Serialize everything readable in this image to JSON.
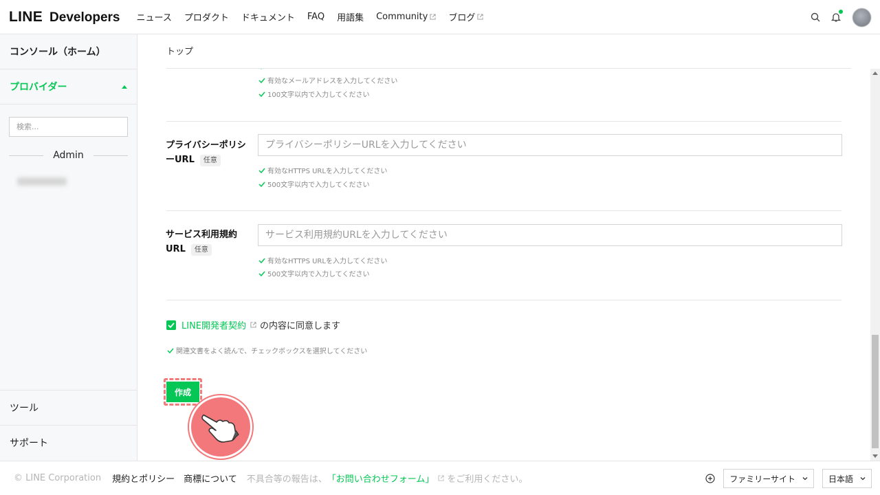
{
  "header": {
    "logo_line": "LINE",
    "logo_dev": "Developers",
    "nav": [
      {
        "label": "ニュース",
        "external": false
      },
      {
        "label": "プロダクト",
        "external": false
      },
      {
        "label": "ドキュメント",
        "external": false
      },
      {
        "label": "FAQ",
        "external": false
      },
      {
        "label": "用語集",
        "external": false
      },
      {
        "label": "Community",
        "external": true
      },
      {
        "label": "ブログ",
        "external": true
      }
    ]
  },
  "sidebar": {
    "console_home": "コンソール（ホーム）",
    "providers": "プロバイダー",
    "search_placeholder": "検索...",
    "admin_label": "Admin",
    "tools": "ツール",
    "support": "サポート"
  },
  "main": {
    "breadcrumb": "トップ",
    "top_checks": [
      "有効なメールアドレスを入力してください",
      "100文字以内で入力してください"
    ],
    "privacy": {
      "label_line1": "プライバシーポリシ",
      "label_line2": "ーURL",
      "optional": "任意",
      "placeholder": "プライバシーポリシーURLを入力してください",
      "checks": [
        "有効なHTTPS URLを入力してください",
        "500文字以内で入力してください"
      ]
    },
    "terms": {
      "label_line1": "サービス利用規約",
      "label_line2": "URL",
      "optional": "任意",
      "placeholder": "サービス利用規約URLを入力してください",
      "checks": [
        "有効なHTTPS URLを入力してください",
        "500文字以内で入力してください"
      ]
    },
    "agreement": {
      "checked": true,
      "link": "LINE開発者契約",
      "text": "の内容に同意します",
      "hint": "関連文書をよく読んで、チェックボックスを選択してください"
    },
    "create_button": "作成"
  },
  "footer": {
    "copyright": "© LINE Corporation",
    "policy": "規約とポリシー",
    "trademark": "商標について",
    "report_prefix": "不具合等の報告は、",
    "report_form": "「お問い合わせフォーム」",
    "report_suffix": "をご利用ください。",
    "family_sites": "ファミリーサイト",
    "language": "日本語"
  },
  "colors": {
    "accent": "#06c755",
    "highlight": "#f2787b"
  }
}
